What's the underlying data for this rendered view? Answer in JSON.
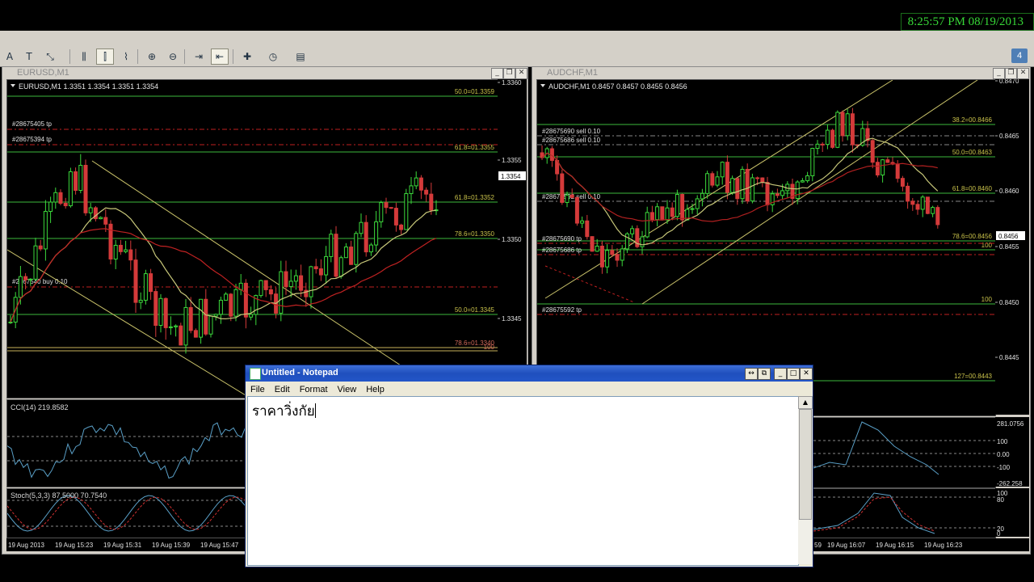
{
  "clock": "8:25:57 PM 08/19/2013",
  "toolbar": {
    "buttons": [
      {
        "name": "text-a-icon",
        "glyph": "A"
      },
      {
        "name": "text-label-icon",
        "glyph": "T"
      },
      {
        "name": "arrows-icon",
        "glyph": "⤡"
      },
      {
        "name": "bar-chart-icon",
        "glyph": "⫼"
      },
      {
        "name": "candlestick-icon",
        "glyph": "⫿"
      },
      {
        "name": "line-chart-icon",
        "glyph": "⌇"
      },
      {
        "name": "zoom-in-icon",
        "glyph": "⊕"
      },
      {
        "name": "zoom-out-icon",
        "glyph": "⊖"
      },
      {
        "name": "autoscroll-icon",
        "glyph": "⇥"
      },
      {
        "name": "chart-shift-icon",
        "glyph": "⇤"
      },
      {
        "name": "indicators-icon",
        "glyph": "✚"
      },
      {
        "name": "periods-icon",
        "glyph": "◷"
      },
      {
        "name": "templates-icon",
        "glyph": "▤"
      }
    ],
    "aside": "4"
  },
  "eurusd": {
    "caption": "EURUSD,M1",
    "ohlc": "EURUSD,M1  1.3351 1.3354 1.3351 1.3354",
    "price_axis": [
      "1.3360",
      "1.3355",
      "1.3350",
      "1.3345"
    ],
    "current_price": "1.3354",
    "fibo": [
      "50.0=01.3359",
      "61.8=01.3355",
      "61.8=01.3352",
      "78.6=01.3350",
      "50.0=01.3345",
      "78.6=01.3340"
    ],
    "fibo_100": "100",
    "orders": [
      "#28675405 tp",
      "#28675394 tp",
      "#2867540 buy 0.10"
    ],
    "cci_label": "CCI(14) 219.8582",
    "stoch_label": "Stoch(5,3,3) 87.5000 70.7540",
    "time_axis": [
      "19 Aug 2013",
      "19 Aug 15:23",
      "19 Aug 15:31",
      "19 Aug 15:39",
      "19 Aug 15:47"
    ]
  },
  "audchf": {
    "caption": "AUDCHF,M1",
    "ohlc": "AUDCHF,M1  0.8457 0.8457 0.8455 0.8456",
    "price_axis": [
      "0.8470",
      "0.8465",
      "0.8460",
      "0.8455",
      "0.8450",
      "0.8445"
    ],
    "current_price": "0.8456",
    "fibo": [
      "38.2=00.8466",
      "50.0=00.8463",
      "61.8=00.8460",
      "78.6=00.8456",
      "100",
      "100",
      "127=00.8443"
    ],
    "orders": [
      "#28675690 sell 0.10",
      "#28675686 sell 0.10",
      "#28675592 sell 0.10",
      "#28675690 tp",
      "#28675686 tp",
      "#28675592 tp"
    ],
    "cci_axis": [
      "281.0756",
      "100",
      "0.00",
      "-100",
      "-262.258"
    ],
    "stoch_axis": [
      "100",
      "80",
      "20",
      "0"
    ],
    "time_axis": [
      "59",
      "19 Aug 16:07",
      "19 Aug 16:15",
      "19 Aug 16:23"
    ]
  },
  "notepad": {
    "title": "Untitled - Notepad",
    "menu": [
      "File",
      "Edit",
      "Format",
      "View",
      "Help"
    ],
    "text": "ราคาวิ่งกัย"
  }
}
